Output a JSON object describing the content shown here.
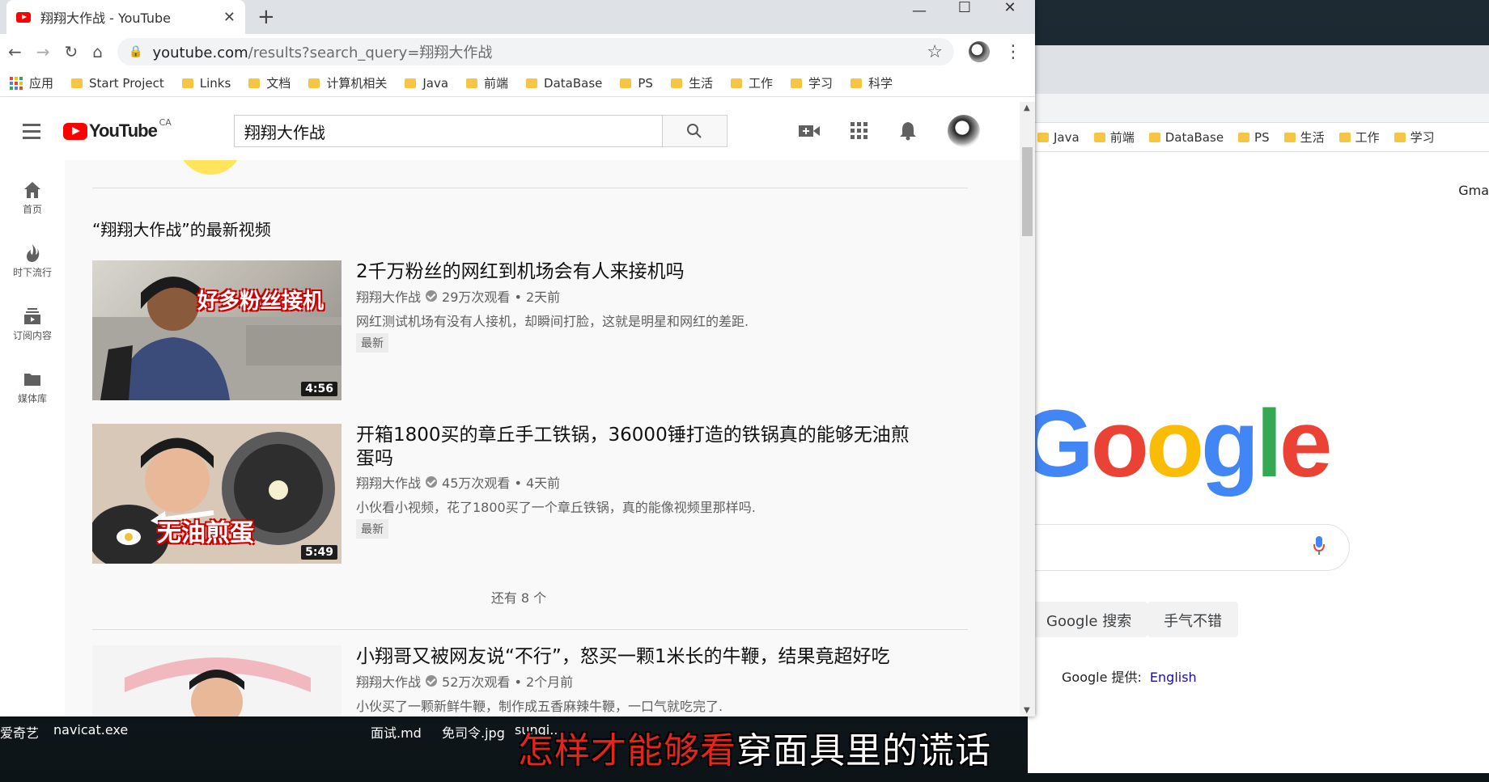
{
  "browser": {
    "tab_title": "翔翔大作战 - YouTube",
    "tab_close": "✕",
    "new_tab": "+",
    "min": "—",
    "max": "☐",
    "close": "✕",
    "url_host": "youtube.com",
    "url_path": "/results?search_query=翔翔大作战",
    "bookmarks": [
      "应用",
      "Start Project",
      "Links",
      "文档",
      "计算机相关",
      "Java",
      "前端",
      "DataBase",
      "PS",
      "生活",
      "工作",
      "学习",
      "科学"
    ]
  },
  "youtube": {
    "logo_text": "YouTube",
    "country": "CA",
    "search_value": "翔翔大作战",
    "nav": [
      {
        "label": "首页",
        "icon": "home-icon"
      },
      {
        "label": "时下流行",
        "icon": "trending-icon"
      },
      {
        "label": "订阅内容",
        "icon": "subscriptions-icon"
      },
      {
        "label": "媒体库",
        "icon": "library-icon"
      }
    ],
    "section_title": "“翔翔大作战”的最新视频",
    "videos": [
      {
        "title": "2千万粉丝的网红到机场会有人来接机吗",
        "channel": "翔翔大作战",
        "meta": "29万次观看 • 2天前",
        "desc": "网红测试机场有没有人接机，却瞬间打脸，这就是明星和网红的差距.",
        "badge": "最新",
        "duration": "4:56",
        "thumb_text": "好多粉丝接机"
      },
      {
        "title": "开箱1800买的章丘手工铁锅，36000锤打造的铁锅真的能够无油煎蛋吗",
        "channel": "翔翔大作战",
        "meta": "45万次观看 • 4天前",
        "desc": "小伙看小视频，花了1800买了一个章丘铁锅，真的能像视频里那样吗.",
        "badge": "最新",
        "duration": "5:49",
        "thumb_text": "无油煎蛋"
      },
      {
        "title": "小翔哥又被网友说“不行”，怒买一颗1米长的牛鞭，结果竟超好吃",
        "channel": "翔翔大作战",
        "meta": "52万次观看 • 2个月前",
        "desc": "小伙买了一颗新鲜牛鞭，制作成五香麻辣牛鞭，一口气就吃完了."
      }
    ],
    "more_label": "还有 8 个"
  },
  "google_window": {
    "bookmarks": [
      "Java",
      "前端",
      "DataBase",
      "PS",
      "生活",
      "工作",
      "学习"
    ],
    "gmail": "Gma",
    "logo": [
      "G",
      "o",
      "o",
      "g",
      "l",
      "e"
    ],
    "btn_search": "Google 搜索",
    "btn_lucky": "手气不错",
    "offered_label": "Google 提供:",
    "offered_lang": "English"
  },
  "desktop": {
    "task_items": [
      "爱奇艺",
      "navicat.exe",
      "面试.md",
      "免司令.jpg",
      "sungi..."
    ],
    "subtitle_red": "怎样才能够看",
    "subtitle_white": "穿面具里的谎话"
  },
  "colors": {
    "yt_red": "#ff0000",
    "google_blue": "#4285f4",
    "google_red": "#ea4335",
    "google_yellow": "#fbbc05",
    "google_green": "#34a853"
  }
}
